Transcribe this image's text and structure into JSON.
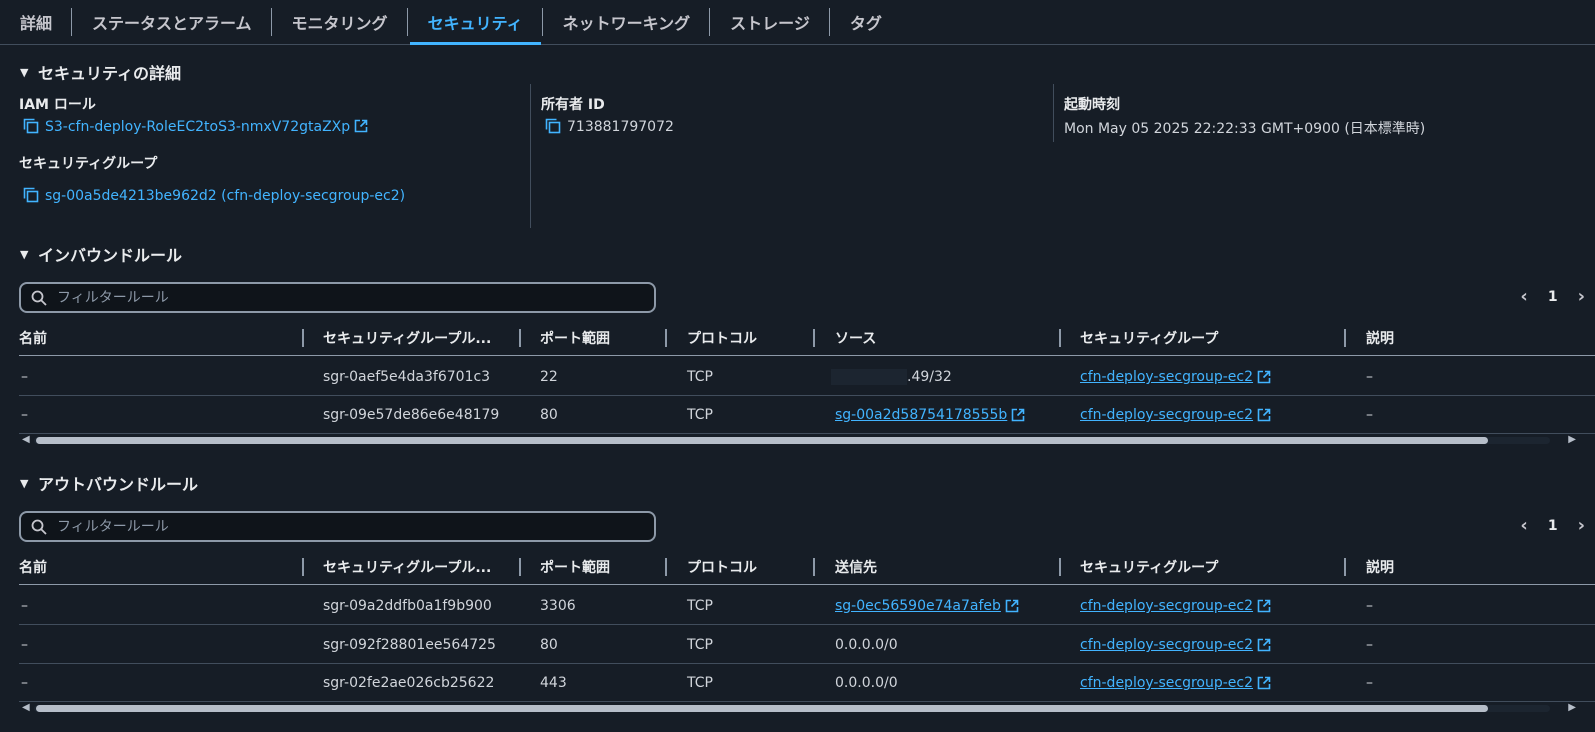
{
  "tabs": [
    {
      "label": "詳細",
      "active": false
    },
    {
      "label": "ステータスとアラーム",
      "active": false
    },
    {
      "label": "モニタリング",
      "active": false
    },
    {
      "label": "セキュリティ",
      "active": true
    },
    {
      "label": "ネットワーキング",
      "active": false
    },
    {
      "label": "ストレージ",
      "active": false
    },
    {
      "label": "タグ",
      "active": false
    }
  ],
  "security_details": {
    "heading": "セキュリティの詳細",
    "iam_role_label": "IAM ロール",
    "iam_role_value": "S3-cfn-deploy-RoleEC2toS3-nmxV72gtaZXp",
    "security_group_label": "セキュリティグループ",
    "security_group_value": "sg-00a5de4213be962d2 (cfn-deploy-secgroup-ec2)",
    "owner_id_label": "所有者 ID",
    "owner_id_value": "713881797072",
    "launch_time_label": "起動時刻",
    "launch_time_value": "Mon May 05 2025 22:22:33 GMT+0900 (日本標準時)"
  },
  "inbound": {
    "heading": "インバウンドルール",
    "filter_placeholder": "フィルタールール",
    "page": "1",
    "columns": [
      "名前",
      "セキュリティグループル...",
      "ポート範囲",
      "プロトコル",
      "ソース",
      "セキュリティグループ",
      "説明"
    ],
    "rows": [
      {
        "name": "–",
        "rule_id": "sgr-0aef5e4da3f6701c3",
        "port": "22",
        "protocol": "TCP",
        "source": ".49/32",
        "source_masked": true,
        "source_link": false,
        "group": "cfn-deploy-secgroup-ec2",
        "description": "–"
      },
      {
        "name": "–",
        "rule_id": "sgr-09e57de86e6e48179",
        "port": "80",
        "protocol": "TCP",
        "source": "sg-00a2d58754178555b",
        "source_masked": false,
        "source_link": true,
        "group": "cfn-deploy-secgroup-ec2",
        "description": "–"
      }
    ]
  },
  "outbound": {
    "heading": "アウトバウンドルール",
    "filter_placeholder": "フィルタールール",
    "page": "1",
    "columns": [
      "名前",
      "セキュリティグループル...",
      "ポート範囲",
      "プロトコル",
      "送信先",
      "セキュリティグループ",
      "説明"
    ],
    "rows": [
      {
        "name": "–",
        "rule_id": "sgr-09a2ddfb0a1f9b900",
        "port": "3306",
        "protocol": "TCP",
        "source": "sg-0ec56590e74a7afeb",
        "source_link": true,
        "group": "cfn-deploy-secgroup-ec2",
        "description": "–"
      },
      {
        "name": "–",
        "rule_id": "sgr-092f28801ee564725",
        "port": "80",
        "protocol": "TCP",
        "source": "0.0.0.0/0",
        "source_link": false,
        "group": "cfn-deploy-secgroup-ec2",
        "description": "–"
      },
      {
        "name": "–",
        "rule_id": "sgr-02fe2ae026cb25622",
        "port": "443",
        "protocol": "TCP",
        "source": "0.0.0.0/0",
        "source_link": false,
        "group": "cfn-deploy-secgroup-ec2",
        "description": "–"
      }
    ]
  },
  "icons": {
    "copy": "copy-icon",
    "external": "external-link-icon",
    "search": "search-icon",
    "caret": "caret-down-icon"
  },
  "colors": {
    "background": "#161d26",
    "accent": "#42b4ff",
    "text": "#d1d5db",
    "border": "#414d5c"
  }
}
